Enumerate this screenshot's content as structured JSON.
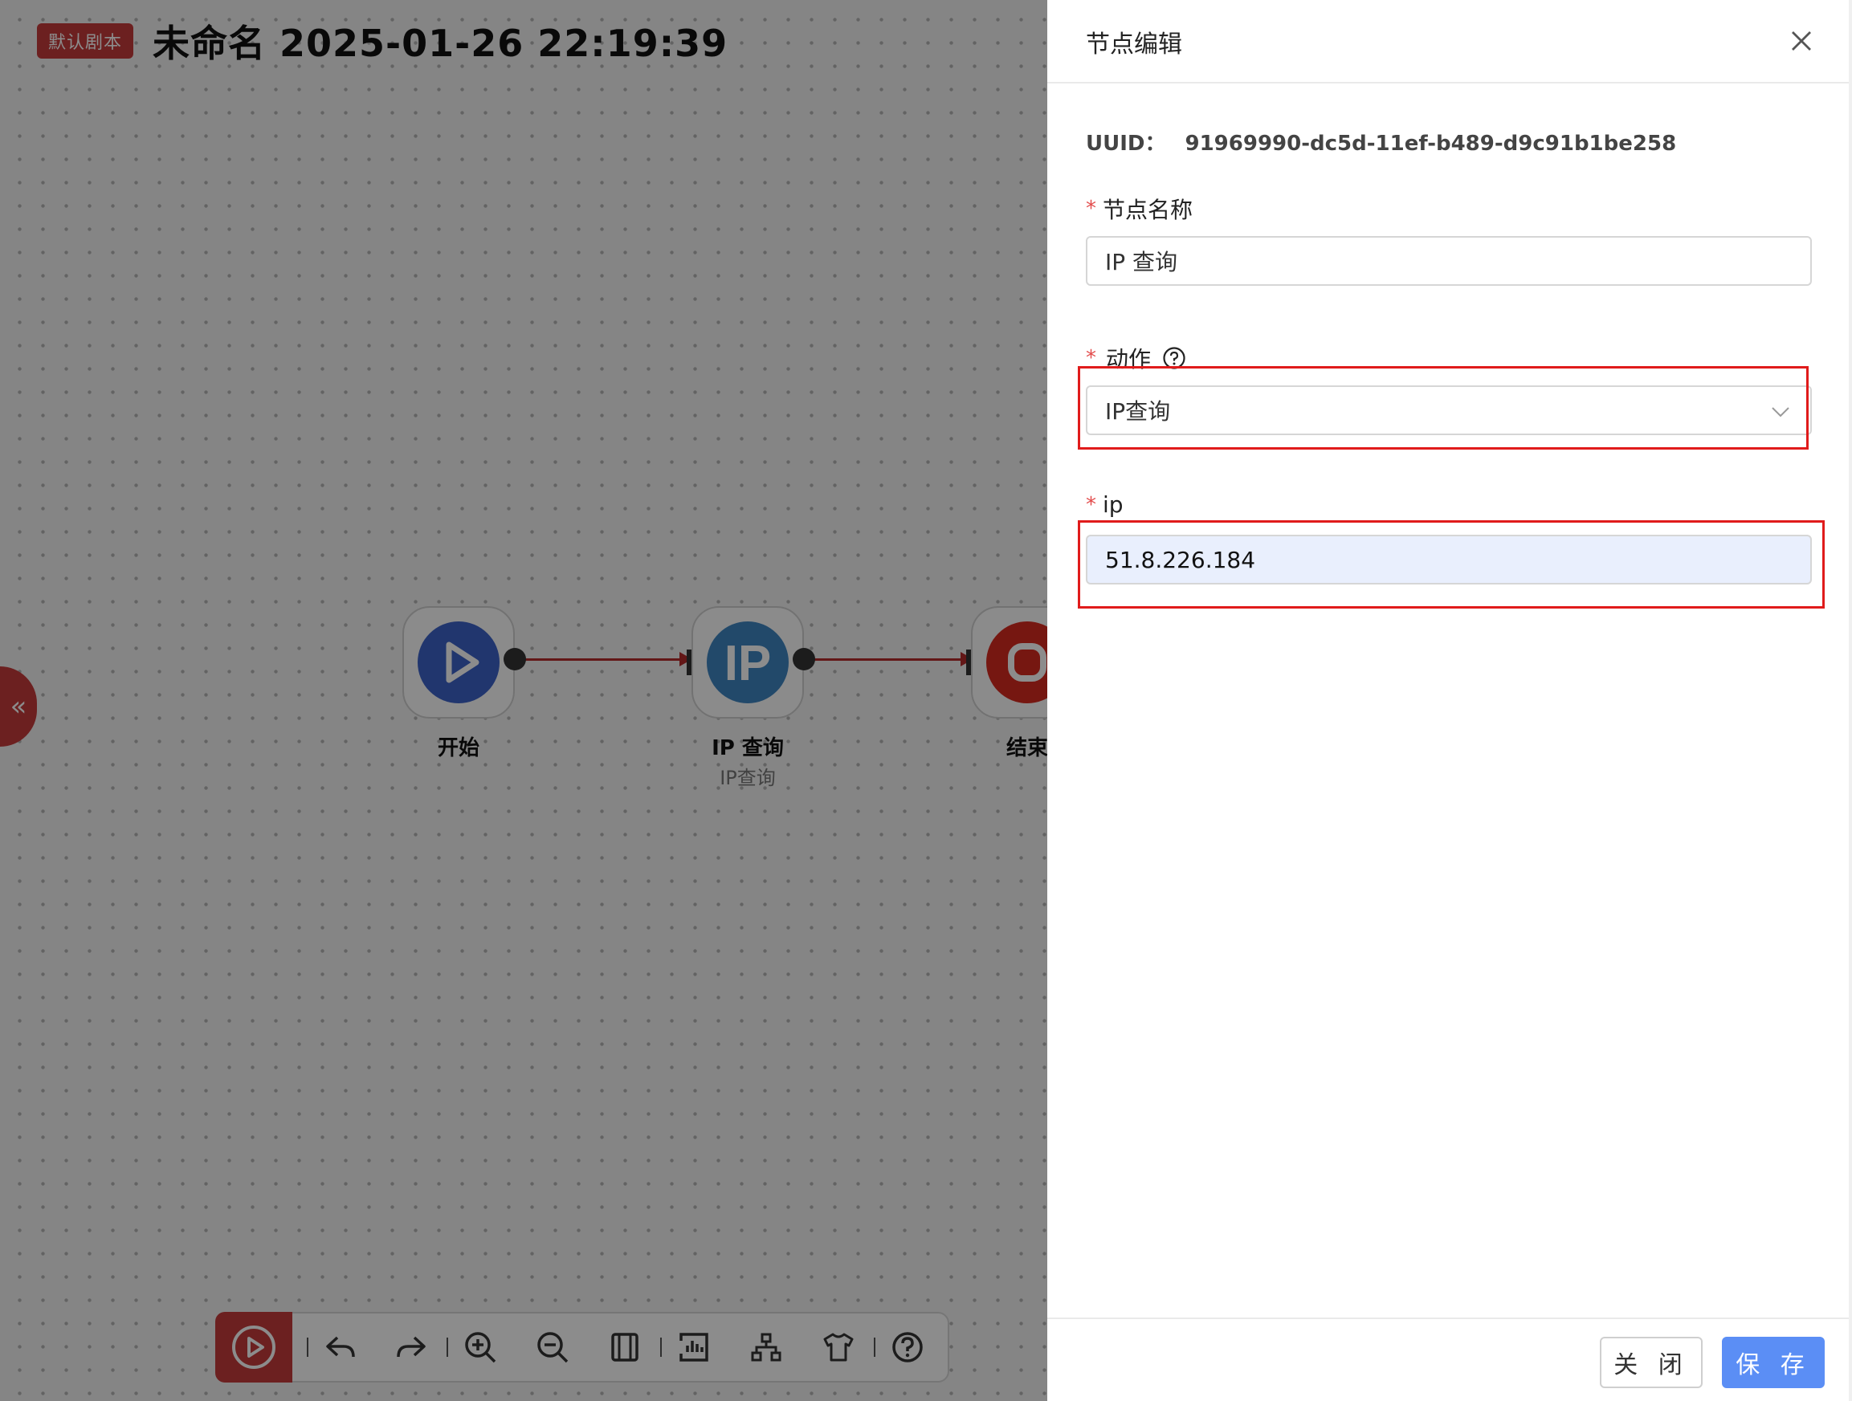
{
  "canvas": {
    "badge": "默认剧本",
    "title": "未命名 2025-01-26 22:19:39",
    "expand_icon": "double-chevron-left-icon",
    "expand_glyph": "«",
    "nodes": [
      {
        "label": "开始",
        "subtitle": "",
        "icon": "play-icon",
        "color": "#3d63c9"
      },
      {
        "label": "IP 查询",
        "subtitle": "IP查询",
        "icon": "ip-icon",
        "icon_text": "IP",
        "color": "#3f85c2"
      },
      {
        "label": "结束",
        "subtitle": "",
        "icon": "stop-icon",
        "color": "#d82a20"
      }
    ],
    "edge_color": "#b52a2a",
    "toolbar": {
      "run_icon": "play-circle-icon",
      "buttons": [
        "undo-icon",
        "redo-icon",
        "zoom-in-icon",
        "zoom-out-icon",
        "fit-icon",
        "chart-icon",
        "tree-layout-icon",
        "theme-shirt-icon",
        "help-icon"
      ]
    }
  },
  "drawer": {
    "title": "节点编辑",
    "uuid_label": "UUID：",
    "uuid_value": "91969990-dc5d-11ef-b489-d9c91b1be258",
    "fields": {
      "name": {
        "label": "节点名称",
        "value": "IP 查询"
      },
      "action": {
        "label": "动作",
        "value": "IP查询"
      },
      "ip": {
        "label": "ip",
        "value": "51.8.226.184"
      }
    },
    "required_mark": "*",
    "footer": {
      "close_label": "关 闭",
      "save_label": "保 存"
    },
    "colors": {
      "accent": "#5b8ef5",
      "highlight": "#e01b1b",
      "brand": "#c53b3b"
    }
  }
}
